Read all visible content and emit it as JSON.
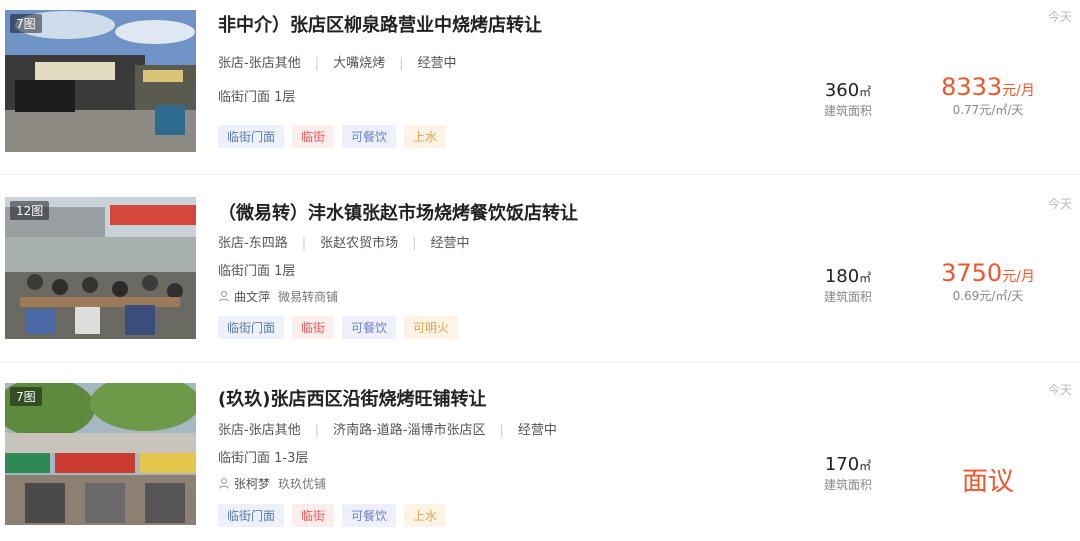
{
  "listings": [
    {
      "photo_count": "7图",
      "title": "非中介）张店区柳泉路营业中烧烤店转让",
      "district": "张店-张店其他",
      "location": "大嘴烧烤",
      "status": "经营中",
      "floor": "临街门面 1层",
      "agent": null,
      "tags": [
        "临街门面",
        "临街",
        "可餐饮",
        "上水"
      ],
      "area_value": "360",
      "area_unit": "㎡",
      "area_label": "建筑面积",
      "price_amount": "8333",
      "price_unit": "元/月",
      "price_daily": "0.77元/㎡/天",
      "date": "今天"
    },
    {
      "photo_count": "12图",
      "title": "（微易转）沣水镇张赵市场烧烤餐饮饭店转让",
      "district": "张店-东四路",
      "location": "张赵农贸市场",
      "status": "经营中",
      "floor": "临街门面 1层",
      "agent": {
        "name": "曲文萍",
        "company": "微易转商铺"
      },
      "tags": [
        "临街门面",
        "临街",
        "可餐饮",
        "可明火"
      ],
      "area_value": "180",
      "area_unit": "㎡",
      "area_label": "建筑面积",
      "price_amount": "3750",
      "price_unit": "元/月",
      "price_daily": "0.69元/㎡/天",
      "date": "今天"
    },
    {
      "photo_count": "7图",
      "title": "(玖玖)张店西区沿街烧烤旺铺转让",
      "district": "张店-张店其他",
      "location": "济南路-道路-淄博市张店区",
      "status": "经营中",
      "floor": "临街门面 1-3层",
      "agent": {
        "name": "张柯梦",
        "company": "玖玖优铺"
      },
      "tags": [
        "临街门面",
        "临街",
        "可餐饮",
        "上水"
      ],
      "area_value": "170",
      "area_unit": "㎡",
      "area_label": "建筑面积",
      "price_negotiable": "面议",
      "date": "今天"
    }
  ],
  "colors": {
    "price": "#f0562e",
    "tag_blue": "#5c7ab4",
    "tag_red": "#ee5a5a",
    "tag_lavender": "#6b7fd6",
    "tag_orange": "#e8a24e"
  },
  "icons": {
    "agent": "person-icon"
  }
}
